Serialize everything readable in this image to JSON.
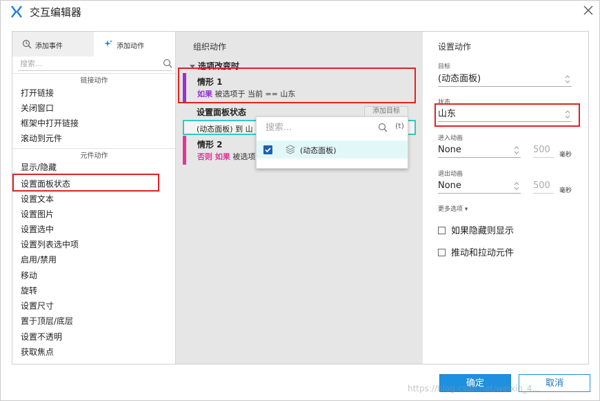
{
  "window": {
    "title": "交互编辑器"
  },
  "left": {
    "tabs": [
      {
        "label": "添加事件",
        "icon": "event-icon"
      },
      {
        "label": "添加动作",
        "icon": "sparkle-icon"
      }
    ],
    "search_placeholder": "搜索...",
    "groups": [
      {
        "title": "链接动作",
        "items": [
          "打开链接",
          "关闭窗口",
          "框架中打开链接",
          "滚动到元件"
        ]
      },
      {
        "title": "元件动作",
        "items": [
          "显示/隐藏",
          "设置面板状态",
          "设置文本",
          "设置图片",
          "设置选中",
          "设置列表选中项",
          "启用/禁用",
          "移动",
          "旋转",
          "设置尺寸",
          "置于顶层/底层",
          "设置不透明",
          "获取焦点"
        ]
      }
    ]
  },
  "middle": {
    "title": "组织动作",
    "event": "选项改变时",
    "cases": [
      {
        "name": "情形 1",
        "keyword": "如果",
        "condition": "被选项于 当前 == 山东",
        "color": "#9b30d6"
      },
      {
        "name": "情形 2",
        "keyword": "否则 如果",
        "condition": "被选项",
        "color": "#e0369a"
      }
    ],
    "action_title": "设置面板状态",
    "add_target_label": "添加目标",
    "action_text": "(动态面板) 到 山"
  },
  "popup": {
    "search_placeholder": "搜索...",
    "option_t": "(t)",
    "items": [
      {
        "label": "(动态面板)",
        "checked": true,
        "icon": "layers-icon"
      }
    ]
  },
  "right": {
    "title": "设置动作",
    "target_label": "目标",
    "target_value": "(动态面板)",
    "state_label": "状态",
    "state_value": "山东",
    "enter_anim_label": "进入动画",
    "enter_anim_value": "None",
    "enter_ms": "500",
    "exit_anim_label": "退出动画",
    "exit_anim_value": "None",
    "exit_ms": "500",
    "unit": "毫秒",
    "more_options": "更多选项 ▾",
    "check1": "如果隐藏则显示",
    "check2": "推动和拉动元件"
  },
  "footer": {
    "ok_label": "确定",
    "cancel_label": "取消",
    "watermark": "https://blog.csdn.net/weixin_4..."
  },
  "colors": {
    "accent": "#1e90e0",
    "highlight": "#e02020",
    "selection": "#2ec8c8"
  }
}
